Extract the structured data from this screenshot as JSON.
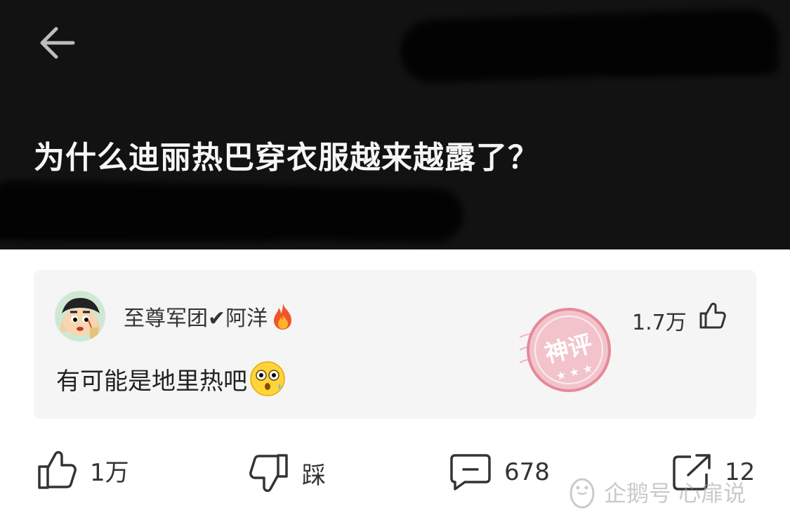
{
  "header": {
    "question_title": "为什么迪丽热巴穿衣服越来越露了？"
  },
  "hot_comment": {
    "author": "至尊军团✔阿洋",
    "author_badge_icon": "fire-icon",
    "likes": "1.7万",
    "text": "有可能是地里热吧",
    "text_emoji": "shocked-face-icon",
    "stamp_text": "神评"
  },
  "actions": {
    "like_count": "1万",
    "dislike_label": "踩",
    "comment_count": "678",
    "share_count": "12"
  },
  "watermark": {
    "text": "企鹅号 心扉说"
  },
  "colors": {
    "header_bg": "#121212",
    "card_bg": "#f5f5f5",
    "stamp": "#e58a98",
    "text": "#333333"
  }
}
